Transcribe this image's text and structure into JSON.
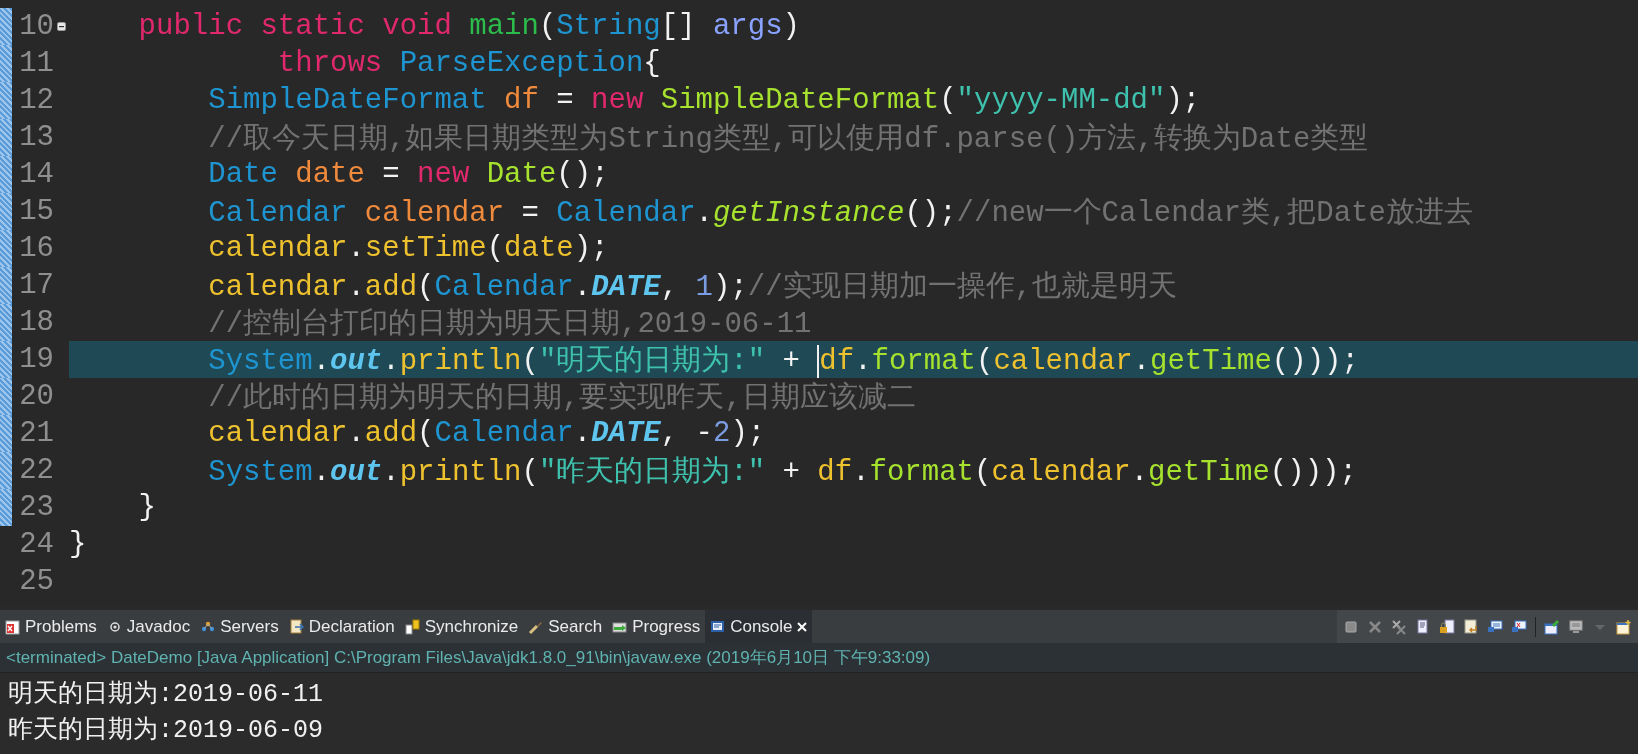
{
  "editor": {
    "lines": [
      {
        "number": "10",
        "changed": true,
        "expanded": true,
        "current": false,
        "tokens": [
          {
            "kind": "keyword",
            "text": "    public static void "
          },
          {
            "kind": "decl",
            "text": "main"
          },
          {
            "kind": "plain",
            "text": "("
          },
          {
            "kind": "type",
            "text": "String"
          },
          {
            "kind": "plain",
            "text": "[] "
          },
          {
            "kind": "param",
            "text": "args"
          },
          {
            "kind": "plain",
            "text": ")"
          }
        ]
      },
      {
        "number": "11",
        "changed": true,
        "current": false,
        "tokens": [
          {
            "kind": "keyword",
            "text": "            throws "
          },
          {
            "kind": "type",
            "text": "ParseException"
          },
          {
            "kind": "plain",
            "text": "{"
          }
        ]
      },
      {
        "number": "12",
        "changed": true,
        "current": false,
        "tokens": [
          {
            "kind": "type",
            "text": "        SimpleDateFormat "
          },
          {
            "kind": "var",
            "text": "df"
          },
          {
            "kind": "plain",
            "text": " = "
          },
          {
            "kind": "keyword",
            "text": "new "
          },
          {
            "kind": "ctor",
            "text": "SimpleDateFormat"
          },
          {
            "kind": "plain",
            "text": "("
          },
          {
            "kind": "string",
            "text": "\"yyyy-MM-dd\""
          },
          {
            "kind": "plain",
            "text": ");"
          }
        ]
      },
      {
        "number": "13",
        "changed": true,
        "current": false,
        "tokens": [
          {
            "kind": "comment",
            "text": "        //取今天日期,如果日期类型为String类型,可以使用df.parse()方法,转换为Date类型"
          }
        ]
      },
      {
        "number": "14",
        "changed": true,
        "current": false,
        "tokens": [
          {
            "kind": "type",
            "text": "        Date "
          },
          {
            "kind": "var",
            "text": "date"
          },
          {
            "kind": "plain",
            "text": " = "
          },
          {
            "kind": "keyword",
            "text": "new "
          },
          {
            "kind": "ctor",
            "text": "Date"
          },
          {
            "kind": "plain",
            "text": "();"
          }
        ]
      },
      {
        "number": "15",
        "changed": true,
        "current": false,
        "tokens": [
          {
            "kind": "type",
            "text": "        Calendar "
          },
          {
            "kind": "var",
            "text": "calendar"
          },
          {
            "kind": "plain",
            "text": " = "
          },
          {
            "kind": "type",
            "text": "Calendar"
          },
          {
            "kind": "plain",
            "text": "."
          },
          {
            "kind": "static-call",
            "text": "getInstance"
          },
          {
            "kind": "plain",
            "text": "();"
          },
          {
            "kind": "comment",
            "text": "//new一个Calendar类,把Date放进去"
          }
        ]
      },
      {
        "number": "16",
        "changed": true,
        "current": false,
        "tokens": [
          {
            "kind": "local",
            "text": "        calendar"
          },
          {
            "kind": "plain",
            "text": "."
          },
          {
            "kind": "method",
            "text": "setTime"
          },
          {
            "kind": "plain",
            "text": "("
          },
          {
            "kind": "local",
            "text": "date"
          },
          {
            "kind": "plain",
            "text": ");"
          }
        ]
      },
      {
        "number": "17",
        "changed": true,
        "current": false,
        "tokens": [
          {
            "kind": "local",
            "text": "        calendar"
          },
          {
            "kind": "plain",
            "text": "."
          },
          {
            "kind": "method",
            "text": "add"
          },
          {
            "kind": "plain",
            "text": "("
          },
          {
            "kind": "type",
            "text": "Calendar"
          },
          {
            "kind": "plain",
            "text": "."
          },
          {
            "kind": "static-field",
            "text": "DATE"
          },
          {
            "kind": "plain",
            "text": ", "
          },
          {
            "kind": "number",
            "text": "1"
          },
          {
            "kind": "plain",
            "text": ");"
          },
          {
            "kind": "comment",
            "text": "//实现日期加一操作,也就是明天"
          }
        ]
      },
      {
        "number": "18",
        "changed": true,
        "current": false,
        "tokens": [
          {
            "kind": "comment",
            "text": "        //控制台打印的日期为明天日期,2019-06-11"
          }
        ]
      },
      {
        "number": "19",
        "changed": true,
        "current": true,
        "tokens": [
          {
            "kind": "type",
            "text": "        System"
          },
          {
            "kind": "plain",
            "text": "."
          },
          {
            "kind": "static-field",
            "text": "out"
          },
          {
            "kind": "plain",
            "text": "."
          },
          {
            "kind": "method",
            "text": "println"
          },
          {
            "kind": "plain",
            "text": "("
          },
          {
            "kind": "string",
            "text": "\"明天的日期为:\""
          },
          {
            "kind": "plain",
            "text": " + "
          },
          {
            "kind": "local",
            "text": "df",
            "caret": true
          },
          {
            "kind": "plain",
            "text": "."
          },
          {
            "kind": "call",
            "text": "format"
          },
          {
            "kind": "plain",
            "text": "("
          },
          {
            "kind": "local",
            "text": "calendar"
          },
          {
            "kind": "plain",
            "text": "."
          },
          {
            "kind": "call",
            "text": "getTime"
          },
          {
            "kind": "plain",
            "text": "()));"
          }
        ]
      },
      {
        "number": "20",
        "changed": true,
        "current": false,
        "tokens": [
          {
            "kind": "comment",
            "text": "        //此时的日期为明天的日期,要实现昨天,日期应该减二"
          }
        ]
      },
      {
        "number": "21",
        "changed": true,
        "current": false,
        "tokens": [
          {
            "kind": "local",
            "text": "        calendar"
          },
          {
            "kind": "plain",
            "text": "."
          },
          {
            "kind": "method",
            "text": "add"
          },
          {
            "kind": "plain",
            "text": "("
          },
          {
            "kind": "type",
            "text": "Calendar"
          },
          {
            "kind": "plain",
            "text": "."
          },
          {
            "kind": "static-field",
            "text": "DATE"
          },
          {
            "kind": "plain",
            "text": ", -"
          },
          {
            "kind": "number",
            "text": "2"
          },
          {
            "kind": "plain",
            "text": ");"
          }
        ]
      },
      {
        "number": "22",
        "changed": true,
        "current": false,
        "tokens": [
          {
            "kind": "type",
            "text": "        System"
          },
          {
            "kind": "plain",
            "text": "."
          },
          {
            "kind": "static-field",
            "text": "out"
          },
          {
            "kind": "plain",
            "text": "."
          },
          {
            "kind": "method",
            "text": "println"
          },
          {
            "kind": "plain",
            "text": "("
          },
          {
            "kind": "string",
            "text": "\"昨天的日期为:\""
          },
          {
            "kind": "plain",
            "text": " + "
          },
          {
            "kind": "local",
            "text": "df"
          },
          {
            "kind": "plain",
            "text": "."
          },
          {
            "kind": "call",
            "text": "format"
          },
          {
            "kind": "plain",
            "text": "("
          },
          {
            "kind": "local",
            "text": "calendar"
          },
          {
            "kind": "plain",
            "text": "."
          },
          {
            "kind": "call",
            "text": "getTime"
          },
          {
            "kind": "plain",
            "text": "()));"
          }
        ]
      },
      {
        "number": "23",
        "changed": true,
        "current": false,
        "tokens": [
          {
            "kind": "plain",
            "text": "    }"
          }
        ]
      },
      {
        "number": "24",
        "changed": false,
        "current": false,
        "tokens": [
          {
            "kind": "plain",
            "text": "}"
          }
        ]
      },
      {
        "number": "25",
        "changed": false,
        "current": false
      }
    ]
  },
  "views": {
    "tabs": [
      {
        "label": "Problems",
        "selected": false,
        "closable": false
      },
      {
        "label": "Javadoc",
        "selected": false,
        "closable": false
      },
      {
        "label": "Servers",
        "selected": false,
        "closable": false
      },
      {
        "label": "Declaration",
        "selected": false,
        "closable": false
      },
      {
        "label": "Synchronize",
        "selected": false,
        "closable": false
      },
      {
        "label": "Search",
        "selected": false,
        "closable": false
      },
      {
        "label": "Progress",
        "selected": false,
        "closable": false
      },
      {
        "label": "Console",
        "selected": true,
        "closable": true
      }
    ]
  },
  "console": {
    "header": "<terminated> DateDemo [Java Application] C:\\Program Files\\Java\\jdk1.8.0_91\\bin\\javaw.exe (2019年6月10日 下午9:33:09)",
    "output": [
      "明天的日期为:2019-06-11",
      "昨天的日期为:2019-06-09"
    ]
  }
}
